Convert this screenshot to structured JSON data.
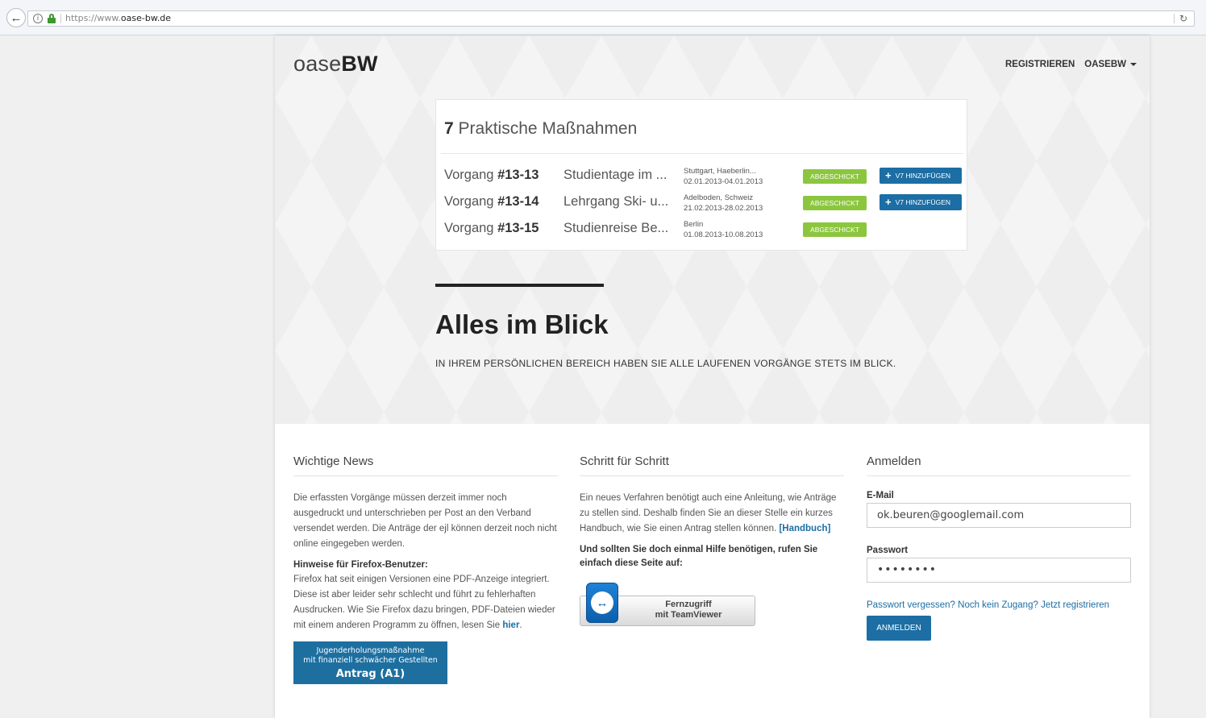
{
  "browser": {
    "url_prefix": "https://www.",
    "url_domain": "oase-bw.de"
  },
  "header": {
    "logo_light": "oase",
    "logo_bold": "BW",
    "nav_register": "REGISTRIEREN",
    "nav_user": "OASEBW"
  },
  "card": {
    "count": "7",
    "title": "Praktische Maßnahmen",
    "rows": [
      {
        "prefix": "Vorgang",
        "code": "#13-13",
        "title": "Studientage im ...",
        "place": "Stuttgart, Haeberlin...",
        "dates": "02.01.2013-04.01.2013",
        "status": "ABGESCHICKT",
        "action": "V7 HINZUFÜGEN"
      },
      {
        "prefix": "Vorgang",
        "code": "#13-14",
        "title": "Lehrgang Ski- u...",
        "place": "Adelboden, Schweiz",
        "dates": "21.02.2013-28.02.2013",
        "status": "ABGESCHICKT",
        "action": "V7 HINZUFÜGEN"
      },
      {
        "prefix": "Vorgang",
        "code": "#13-15",
        "title": "Studienreise Be...",
        "place": "Berlin",
        "dates": "01.08.2013-10.08.2013",
        "status": "ABGESCHICKT",
        "action": ""
      }
    ]
  },
  "hero": {
    "headline": "Alles im Blick",
    "subline": "IN IHREM PERSÖNLICHEN BEREICH HABEN SIE ALLE LAUFENEN VORGÄNGE STETS IM BLICK."
  },
  "news": {
    "title": "Wichtige News",
    "text1": "Die erfassten Vorgänge müssen derzeit immer noch ausgedruckt und unterschrieben per Post an den Verband versendet werden. Die Anträge der ejl können derzeit noch nicht online eingegeben werden.",
    "firefox_heading": "Hinweise für Firefox-Benutzer:",
    "firefox_text": "Firefox hat seit einigen Versionen eine PDF-Anzeige integriert. Diese ist aber leider sehr schlecht und führt zu fehlerhaften Ausdrucken. Wie Sie Firefox dazu bringen, PDF-Dateien wieder mit einem anderen Programm zu öffnen, lesen Sie",
    "firefox_link": "hier",
    "antrag_line1": "Jugenderholungsmaßnahme",
    "antrag_line2": "mit finanziell schwächer Gestellten",
    "antrag_line3": "Antrag (A1)"
  },
  "steps": {
    "title": "Schritt für Schritt",
    "text": "Ein neues Verfahren benötigt auch eine Anleitung, wie Anträge zu stellen sind. Deshalb finden Sie an dieser Stelle ein kurzes Handbuch, wie Sie einen Antrag stellen können.",
    "handbook_link": "[Handbuch]",
    "help_text": "Und sollten Sie doch einmal Hilfe benötigen, rufen Sie einfach diese Seite auf:",
    "tv_line1": "Fernzugriff",
    "tv_line2": "mit TeamViewer"
  },
  "login": {
    "title": "Anmelden",
    "email_label": "E-Mail",
    "email_value": "ok.beuren@googlemail.com",
    "password_label": "Passwort",
    "password_value": "••••••••",
    "forgot_text": "Passwort vergessen? Noch kein Zugang? Jetzt registrieren",
    "submit_label": "ANMELDEN"
  },
  "colors": {
    "accent": "#1c6ea4",
    "status_green": "#8cc63f"
  }
}
